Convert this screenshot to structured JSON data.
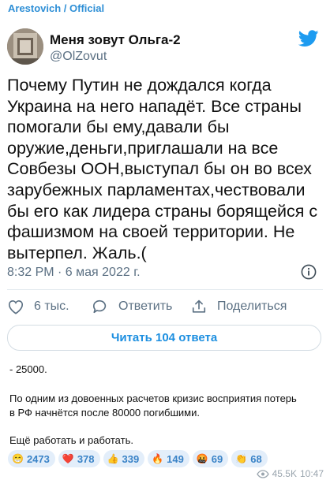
{
  "channel": {
    "title": "Arestovich / Official"
  },
  "tweet": {
    "author_name": "Меня зовут Ольга-2",
    "author_handle": "@OlZovut",
    "text_lines": [
      "Почему Путин не дождался когда",
      "Украина на него нападёт. Все страны",
      "помогали бы ему,давали бы",
      "оружие,деньги,приглашали на все",
      "Совбезы ООН,выступал бы он во всех",
      "зарубежных парламентах,чествовали",
      "бы его как лидера страны борящейся с",
      "фашизмом на своей территории. Не",
      "вытерпел. Жаль.("
    ],
    "timestamp": "8:32 PM · 6 мая 2022 г.",
    "likes": "6 тыс.",
    "reply_label": "Ответить",
    "share_label": "Поделиться",
    "read_replies_label": "Читать 104 ответа"
  },
  "message": {
    "line1": "- 25000.",
    "line2": "По одним из довоенных расчетов кризис восприятия потерь",
    "line3": "в РФ начнётся после 80000 погибшими.",
    "line4": "Ещё работать и работать."
  },
  "reactions": [
    {
      "emoji": "😁",
      "icon": "grin-emoji-icon",
      "count": "2473"
    },
    {
      "emoji": "❤️",
      "icon": "heart-emoji-icon",
      "count": "378"
    },
    {
      "emoji": "👍",
      "icon": "thumbs-up-emoji-icon",
      "count": "339"
    },
    {
      "emoji": "🔥",
      "icon": "fire-emoji-icon",
      "count": "149"
    },
    {
      "emoji": "🤬",
      "icon": "angry-emoji-icon",
      "count": "69"
    },
    {
      "emoji": "👏",
      "icon": "clap-emoji-icon",
      "count": "68"
    }
  ],
  "footer": {
    "views": "45.5K",
    "time": "10:47"
  },
  "colors": {
    "accent": "#2e8fd6",
    "twitter_blue": "#1d9bf0",
    "muted": "#5b7083",
    "reaction_bg": "#e3eefa"
  }
}
